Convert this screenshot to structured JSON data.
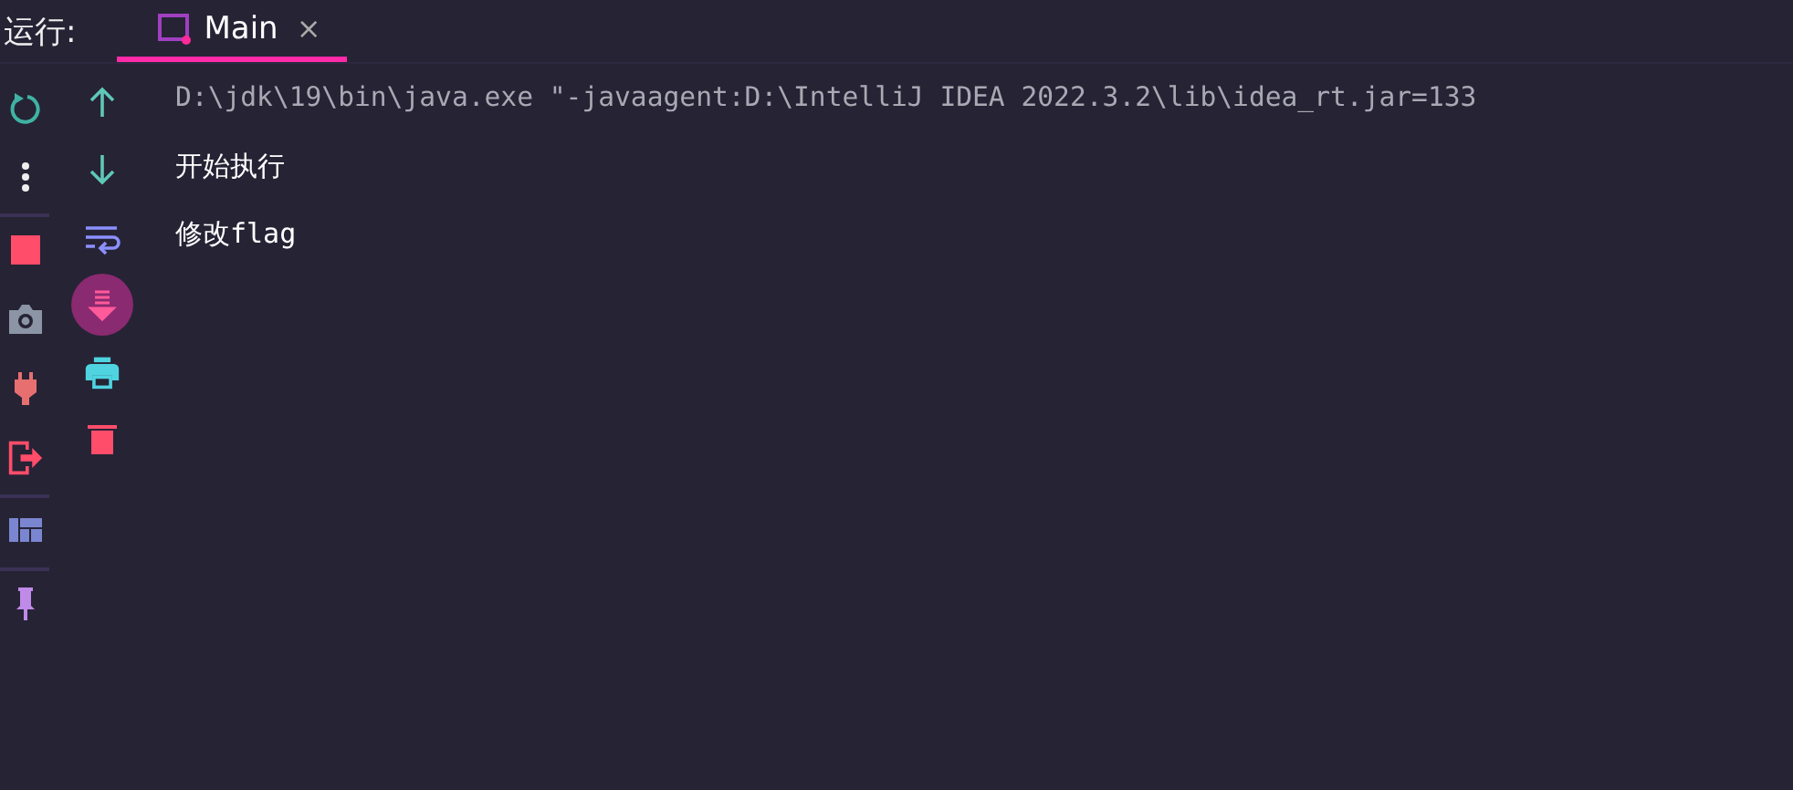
{
  "run_panel": {
    "label": "运行:",
    "tabs": [
      {
        "label": "Main",
        "close": "×",
        "selected": true
      }
    ]
  },
  "left_toolbar": [
    {
      "kind": "rerun"
    },
    {
      "kind": "more"
    },
    {
      "kind": "divider"
    },
    {
      "kind": "stop"
    },
    {
      "kind": "camera"
    },
    {
      "kind": "plug"
    },
    {
      "kind": "exit"
    },
    {
      "kind": "divider"
    },
    {
      "kind": "layout"
    },
    {
      "kind": "divider"
    },
    {
      "kind": "pin"
    }
  ],
  "console_toolbar": [
    {
      "kind": "up",
      "on": false
    },
    {
      "kind": "down",
      "on": false
    },
    {
      "kind": "wrap",
      "on": false
    },
    {
      "kind": "scroll-end",
      "on": true
    },
    {
      "kind": "print",
      "on": false
    },
    {
      "kind": "trash",
      "on": false
    }
  ],
  "console": {
    "lines": [
      {
        "kind": "command",
        "text": "D:\\jdk\\19\\bin\\java.exe \"-javaagent:D:\\IntelliJ IDEA 2022.3.2\\lib\\idea_rt.jar=133"
      },
      {
        "kind": "output",
        "text": "开始执行"
      },
      {
        "kind": "output",
        "text": "修改flag"
      }
    ]
  }
}
